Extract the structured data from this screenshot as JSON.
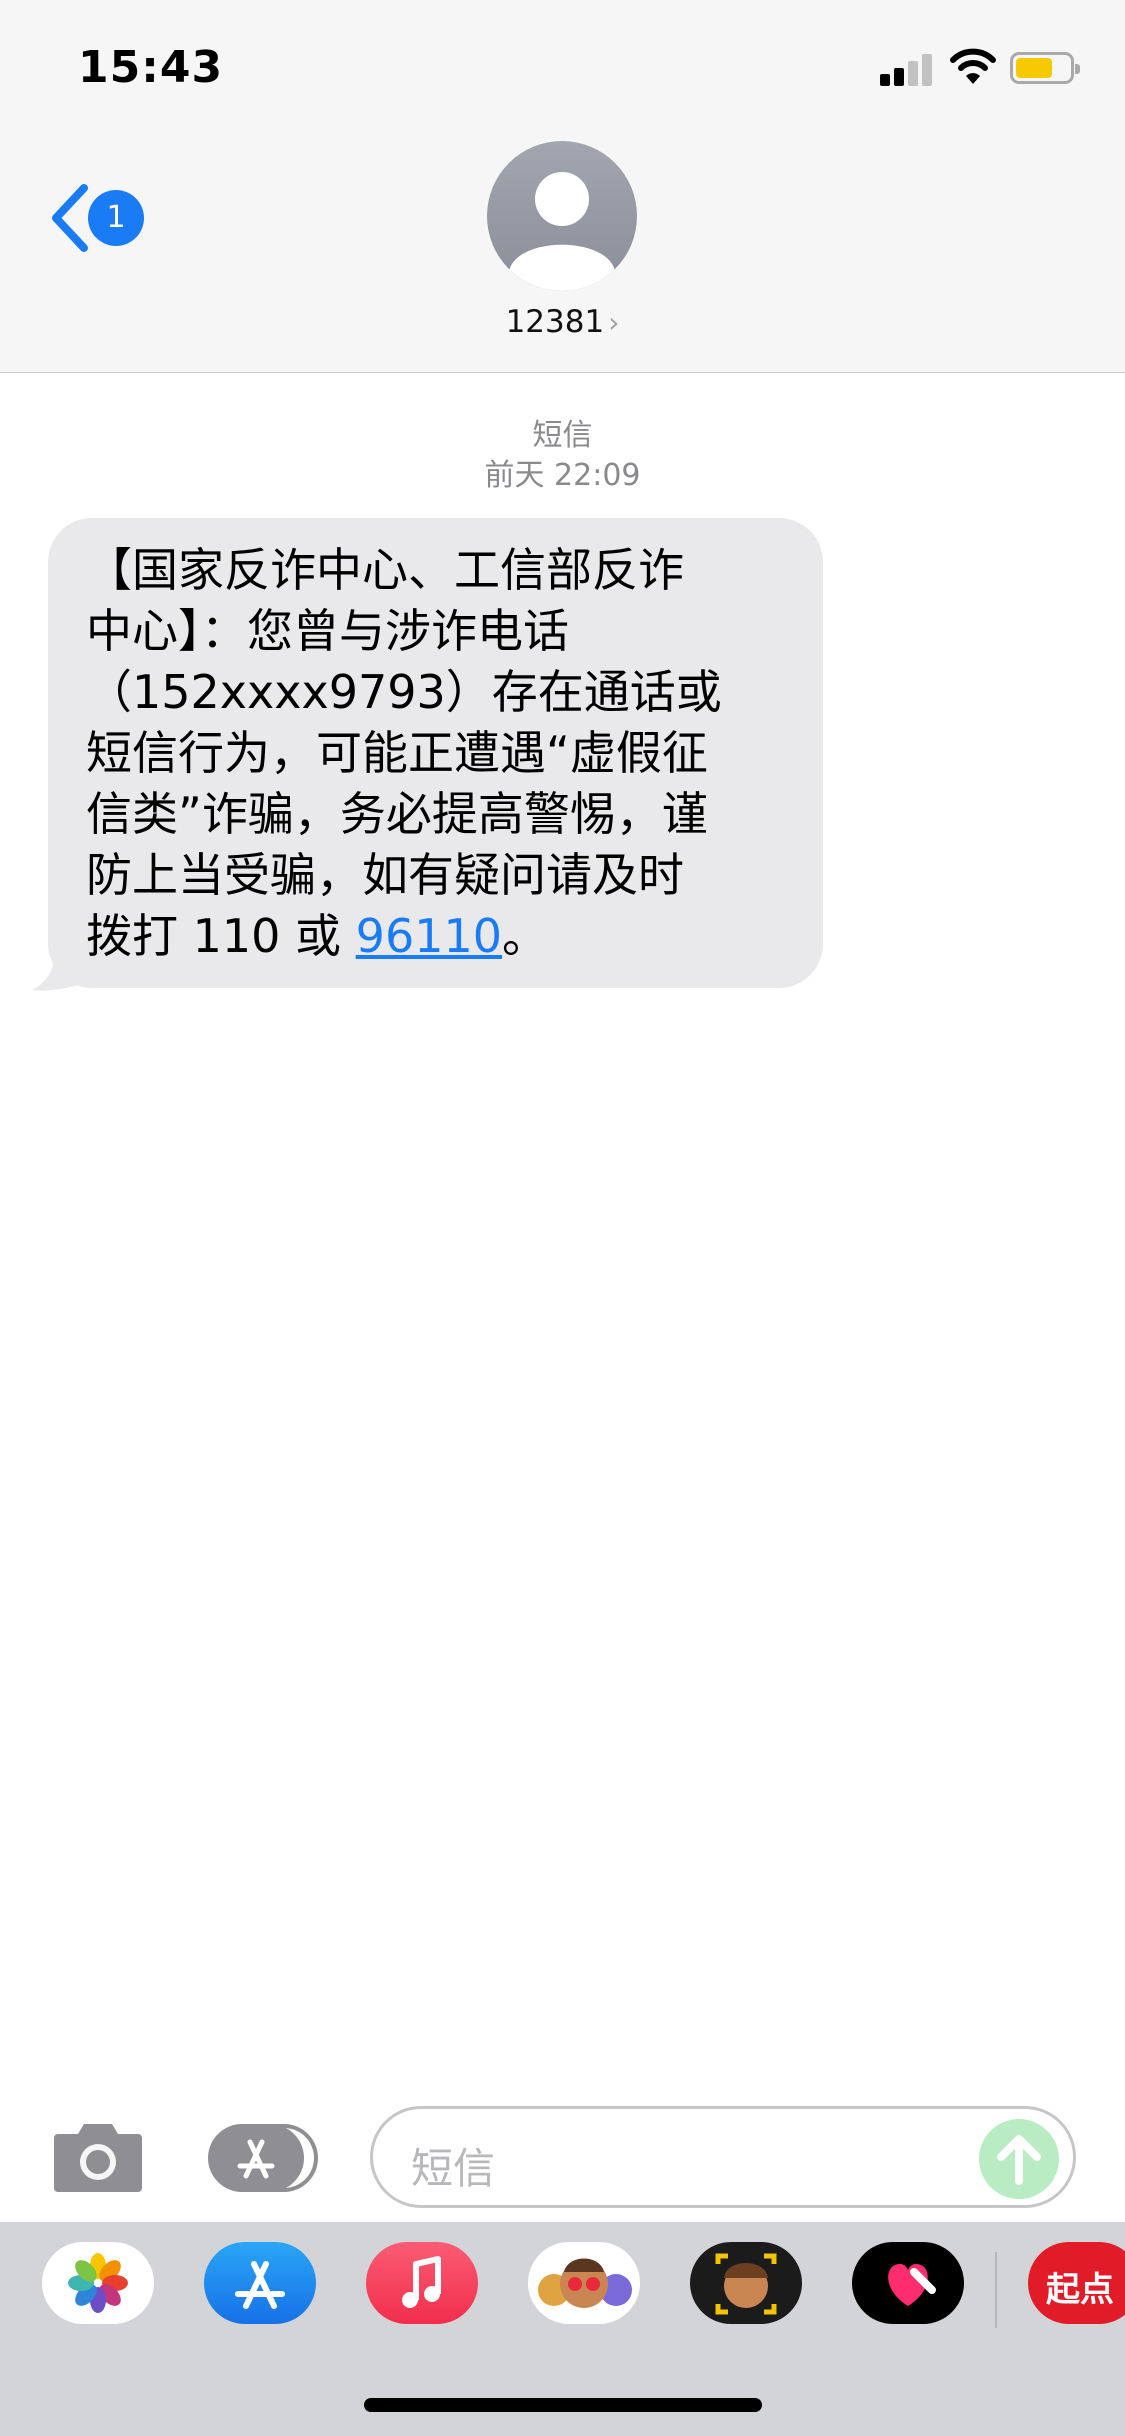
{
  "status_bar": {
    "time": "15:43"
  },
  "header": {
    "back_badge": "1",
    "contact_name": "12381",
    "contact_chevron": "›"
  },
  "thread": {
    "service_label": "短信",
    "timestamp": "前天 22:09",
    "message": {
      "text": "【国家反诈中心、工信部反诈\n中心】：您曾与涉诈电话\n（152xxxx9793）存在通话或\n短信行为，可能正遭遇“虚假征\n信类”诈骗，务必提高警惕，谨\n防上当受骗，如有疑问请及时\n拨打 110 或 ",
      "link": "96110",
      "tail": "。"
    }
  },
  "input_bar": {
    "placeholder": "短信",
    "send_color": "#b9ecc3"
  },
  "app_drawer": {
    "apps": [
      {
        "name": "photos-icon"
      },
      {
        "name": "app-store-icon"
      },
      {
        "name": "music-icon"
      },
      {
        "name": "memoji-stickers-icon"
      },
      {
        "name": "memoji-camera-icon"
      },
      {
        "name": "digital-touch-icon"
      },
      {
        "name": "qidian-app-icon",
        "label": "起点"
      }
    ]
  },
  "colors": {
    "accent": "#1a7cf5",
    "bubble": "#e9e9eb",
    "header_bg": "#f6f6f6",
    "drawer_bg": "#d3d4d8"
  }
}
